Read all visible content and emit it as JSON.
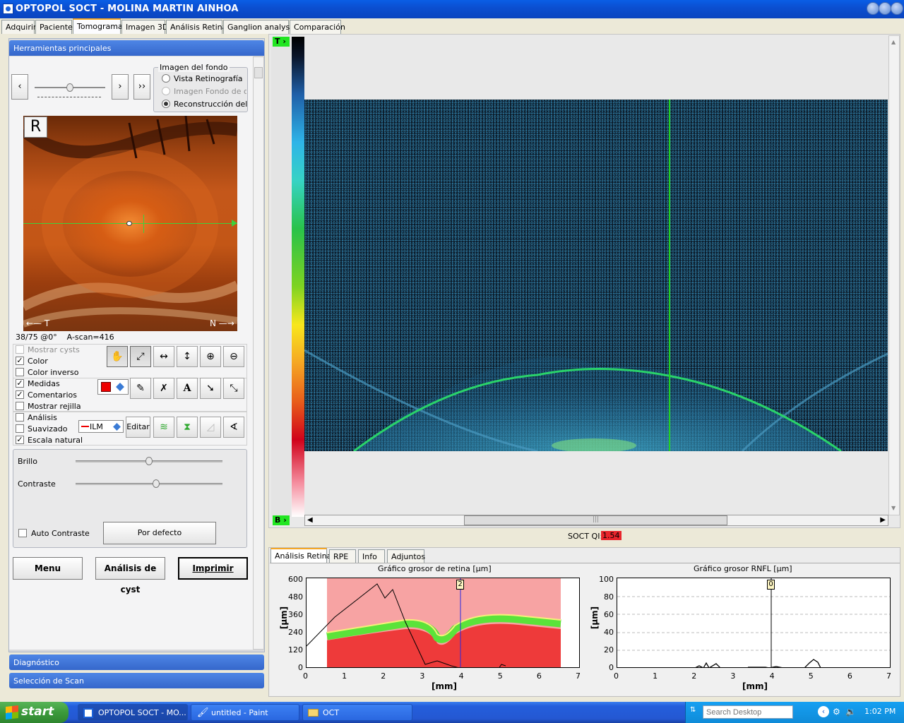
{
  "window": {
    "title": "OPTOPOL SOCT - MOLINA MARTIN AINHOA"
  },
  "tabs": [
    "Adquirir",
    "Paciente",
    "Tomograma",
    "Imagen 3D",
    "Análisis Retina",
    "Ganglion analysis",
    "Comparación"
  ],
  "left": {
    "main_tools_header": "Herramientas principales",
    "nav": {
      "prev": "‹",
      "next": "›",
      "fast": "››"
    },
    "fondo": {
      "title": "Imagen del fondo",
      "options": [
        "Vista Retinografía",
        "Imagen Fondo de ojo",
        "Reconstrucción del fon"
      ],
      "selected": 2
    },
    "fundus": {
      "eye": "R",
      "left_arrow": "T",
      "right_arrow": "N",
      "info": "38/75 @0°    A-scan=416"
    },
    "checks": [
      {
        "label": "Mostrar cysts",
        "checked": false,
        "disabled": true
      },
      {
        "label": "Color",
        "checked": true,
        "disabled": false
      },
      {
        "label": "Color inverso",
        "checked": false,
        "disabled": false
      },
      {
        "label": "Medidas",
        "checked": true,
        "disabled": false
      },
      {
        "label": "Comentarios",
        "checked": true,
        "disabled": false
      },
      {
        "label": "Mostrar rejilla",
        "checked": false,
        "disabled": false
      },
      {
        "label": "Análisis",
        "checked": false,
        "disabled": false
      },
      {
        "label": "Suavizado",
        "checked": false,
        "disabled": false
      },
      {
        "label": "Escala natural",
        "checked": true,
        "disabled": false
      }
    ],
    "layer_select": "ILM",
    "edit_label": "Editar",
    "brillo_label": "Brillo",
    "contraste_label": "Contraste",
    "auto_contraste": "Auto Contraste",
    "por_defecto": "Por defecto",
    "brillo_level": 0.5,
    "contraste_level": 0.55,
    "buttons": {
      "menu": "Menu",
      "cyst": "Análisis de cyst",
      "print": "Imprimir"
    },
    "diagnostico": "Diagnóstico",
    "seleccion": "Selección de Scan"
  },
  "tomogram": {
    "top_marker": "T",
    "bottom_marker": "B",
    "qi_label": "SOCT QI:",
    "qi_value": "1.54"
  },
  "bottom_tabs": [
    "Análisis Retina",
    "RPE",
    "Info",
    "Adjuntos"
  ],
  "graphs": {
    "retina": {
      "title": "Gráfico grosor de retina [µm]",
      "ylabel": "[µm]",
      "xlabel": "[mm]",
      "yticks": [
        "600",
        "480",
        "360",
        "240",
        "120",
        "0"
      ],
      "xticks": [
        "0",
        "1",
        "2",
        "3",
        "4",
        "5",
        "6",
        "7"
      ],
      "marker": "2"
    },
    "rnfl": {
      "title": "Gráfico grosor RNFL  [µm]",
      "ylabel": "[µm]",
      "xlabel": "[mm]",
      "yticks": [
        "100",
        "80",
        "60",
        "40",
        "20",
        "0"
      ],
      "xticks": [
        "0",
        "1",
        "2",
        "3",
        "4",
        "5",
        "6",
        "7"
      ],
      "marker": "0"
    }
  },
  "taskbar": {
    "start": "start",
    "tasks": [
      "OPTOPOL SOCT - MO...",
      "untitled - Paint",
      "OCT"
    ],
    "search_placeholder": "Search Desktop",
    "clock": "1:02 PM"
  },
  "colors": {
    "xp_blue": "#0b4fd1",
    "panel_header": "#3567cb",
    "qi_badge": "#e8242c",
    "retina_band": "#5be33a",
    "retina_fill_top": "#f7a3a3",
    "retina_fill_bottom": "#ee3a3a",
    "scan_line": "#3dd13d"
  }
}
